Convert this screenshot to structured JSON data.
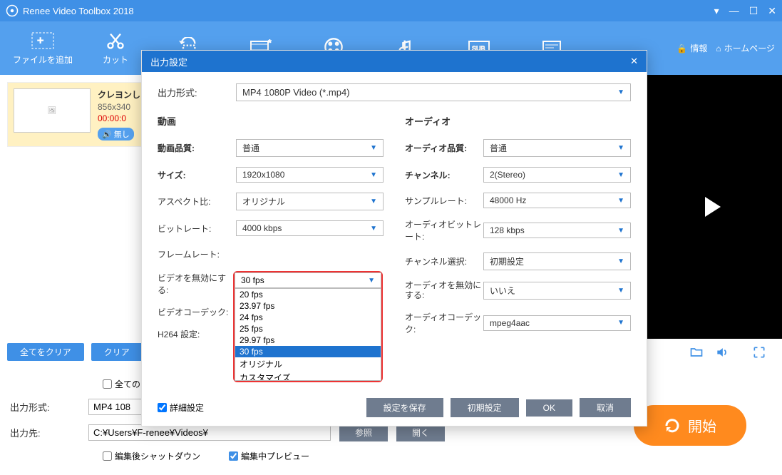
{
  "app": {
    "title": "Renee Video Toolbox 2018"
  },
  "toolbar": {
    "items": [
      "ファイルを追加",
      "カット",
      "",
      "",
      "",
      "",
      "",
      "",
      ""
    ],
    "info": "情報",
    "home": "ホームページ"
  },
  "file": {
    "name": "クレヨンし",
    "res": "856x340",
    "time": "00:00:0",
    "mute": "無し"
  },
  "buttons": {
    "clearAll": "全てをクリア",
    "clear": "クリア"
  },
  "bottom": {
    "allChk": "全ての",
    "outFmtLabel": "出力形式:",
    "outFmtVal": "MP4 108",
    "outDirLabel": "出力先:",
    "outDirVal": "C:¥Users¥F-renee¥Videos¥",
    "browse": "参照",
    "open": "開く",
    "shutdown": "編集後シャットダウン",
    "preview": "編集中プレビュー",
    "start": "開始"
  },
  "dialog": {
    "title": "出力設定",
    "outFmtLabel": "出力形式:",
    "outFmtVal": "MP4 1080P Video (*.mp4)",
    "videoHdr": "動画",
    "audioHdr": "オーディオ",
    "vq": {
      "label": "動画品質:",
      "val": "普通"
    },
    "size": {
      "label": "サイズ:",
      "val": "1920x1080"
    },
    "aspect": {
      "label": "アスペクト比:",
      "val": "オリジナル"
    },
    "bitrate": {
      "label": "ビットレート:",
      "val": "4000 kbps"
    },
    "framerate": {
      "label": "フレームレート:",
      "selected": "30 fps",
      "options": [
        "20 fps",
        "23.97 fps",
        "24 fps",
        "25 fps",
        "29.97 fps",
        "30 fps",
        "オリジナル",
        "カスタマイズ"
      ]
    },
    "vdisable": {
      "label": "ビデオを無効にする:"
    },
    "vcodec": {
      "label": "ビデオコーデック:"
    },
    "h264": {
      "label": "H264 設定:"
    },
    "aq": {
      "label": "オーディオ品質:",
      "val": "普通"
    },
    "ch": {
      "label": "チャンネル:",
      "val": "2(Stereo)"
    },
    "sr": {
      "label": "サンプルレート:",
      "val": "48000 Hz"
    },
    "abr": {
      "label": "オーディオビットレート:",
      "val": "128 kbps"
    },
    "chsel": {
      "label": "チャンネル選択:",
      "val": "初期設定"
    },
    "adisable": {
      "label": "オーディオを無効にする:",
      "val": "いいえ"
    },
    "acodec": {
      "label": "オーディオコーデック:",
      "val": "mpeg4aac"
    },
    "adv": "詳細設定",
    "save": "設定を保存",
    "reset": "初期設定",
    "ok": "OK",
    "cancel": "取消"
  }
}
